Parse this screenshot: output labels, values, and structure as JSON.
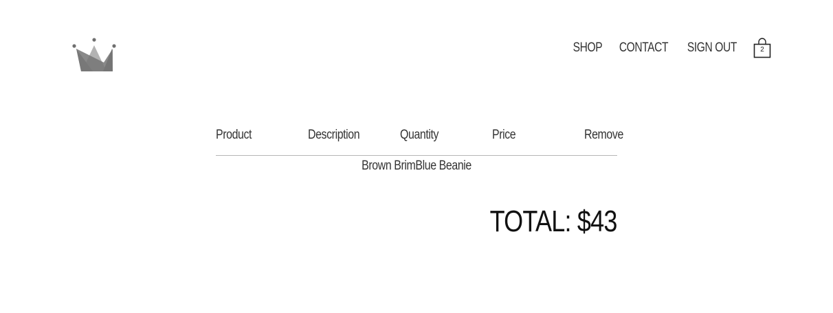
{
  "header": {
    "logo_icon": "crown-icon",
    "nav": [
      {
        "label": "SHOP"
      },
      {
        "label": "CONTACT"
      },
      {
        "label": "SIGN OUT"
      }
    ],
    "cart": {
      "icon": "shopping-bag-icon",
      "count": "2"
    }
  },
  "checkout": {
    "columns": [
      "Product",
      "Description",
      "Quantity",
      "Price",
      "Remove"
    ],
    "items_text": "Brown BrimBlue Beanie"
  },
  "total": {
    "text": "TOTAL: $43"
  },
  "colors": {
    "crown_light": "#a9a9a9",
    "crown_dark": "#6f6f6f",
    "divider": "#b5b5b5",
    "text": "#333333"
  }
}
